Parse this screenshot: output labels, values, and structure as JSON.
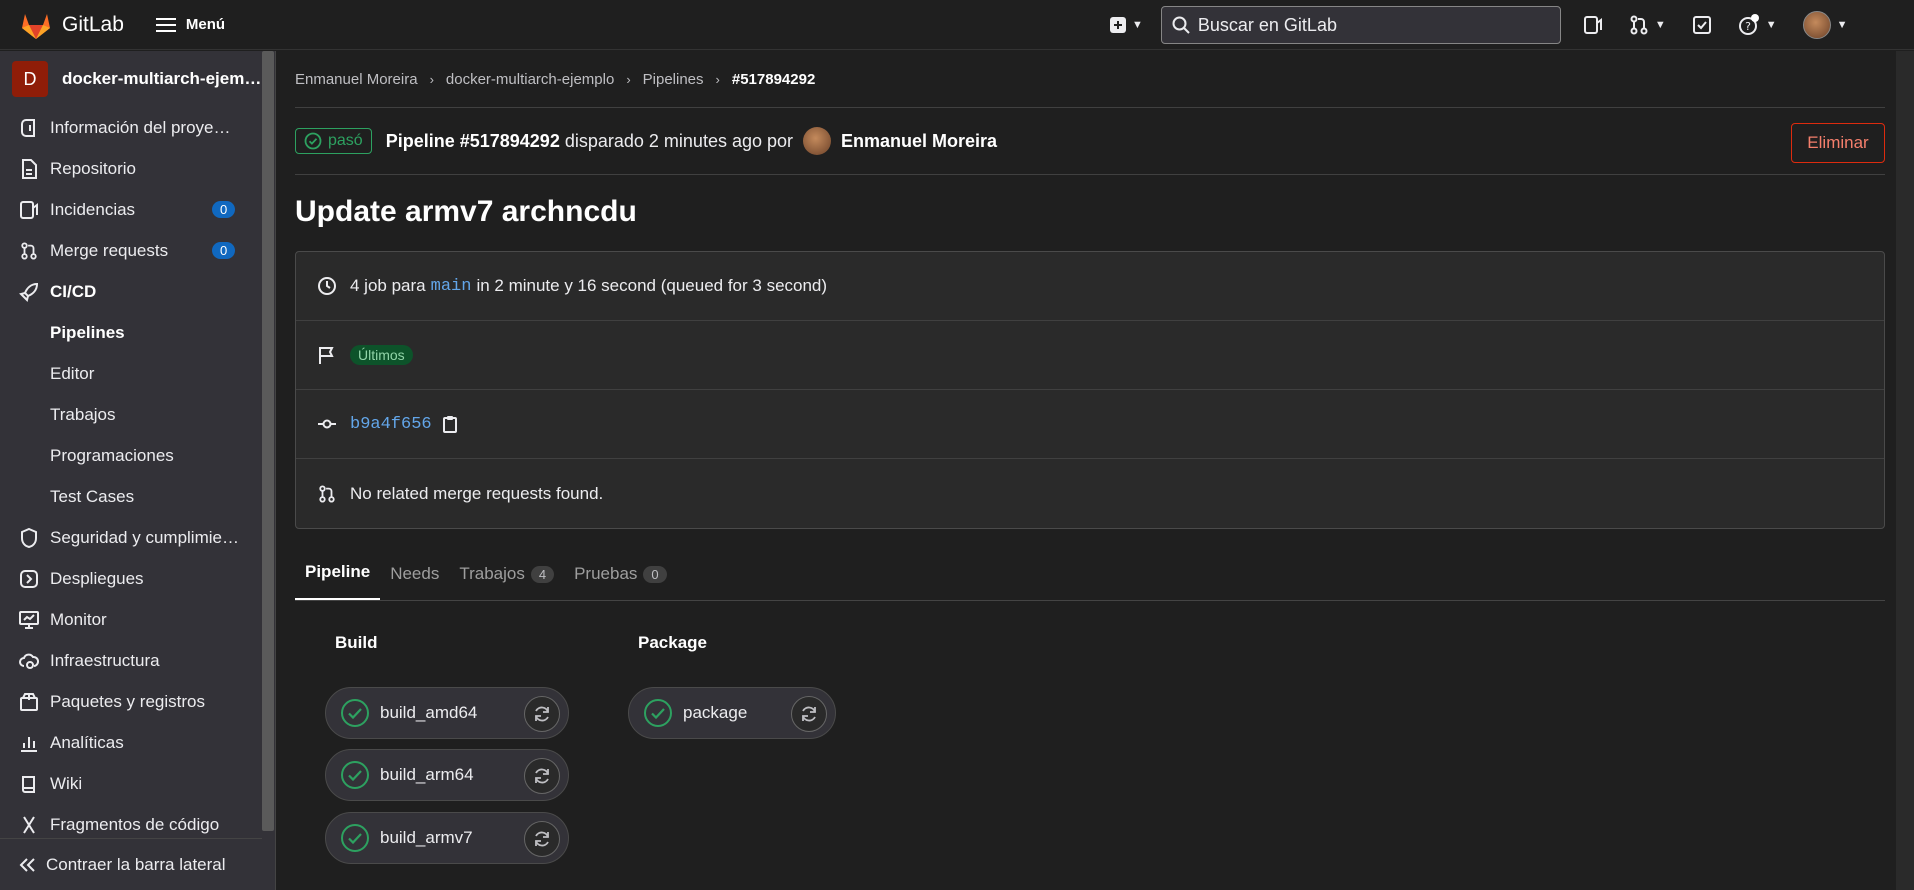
{
  "topbar": {
    "brand": "GitLab",
    "menu_label": "Menú",
    "search_placeholder": "Buscar en GitLab"
  },
  "sidebar": {
    "project_initial": "D",
    "project_name": "docker-multiarch-ejemplo",
    "items": [
      {
        "label": "Información del proye…",
        "icon": "info-icon"
      },
      {
        "label": "Repositorio",
        "icon": "doc-icon"
      },
      {
        "label": "Incidencias",
        "icon": "issues-icon",
        "count": "0"
      },
      {
        "label": "Merge requests",
        "icon": "merge-request-icon",
        "count": "0"
      },
      {
        "label": "CI/CD",
        "icon": "rocket-icon"
      }
    ],
    "cicd_sub": [
      "Pipelines",
      "Editor",
      "Trabajos",
      "Programaciones",
      "Test Cases"
    ],
    "items_after": [
      {
        "label": "Seguridad y cumplimie…",
        "icon": "shield-icon"
      },
      {
        "label": "Despliegues",
        "icon": "deployments-icon"
      },
      {
        "label": "Monitor",
        "icon": "monitor-icon"
      },
      {
        "label": "Infraestructura",
        "icon": "cloud-gear-icon"
      },
      {
        "label": "Paquetes y registros",
        "icon": "package-icon"
      },
      {
        "label": "Analíticas",
        "icon": "chart-icon"
      },
      {
        "label": "Wiki",
        "icon": "book-icon"
      },
      {
        "label": "Fragmentos de código",
        "icon": "snippet-icon"
      }
    ],
    "collapse_label": "Contraer la barra lateral"
  },
  "breadcrumb": [
    "Enmanuel Moreira",
    "docker-multiarch-ejemplo",
    "Pipelines",
    "#517894292"
  ],
  "pipeline": {
    "status": "pasó",
    "id_label": "Pipeline #517894292",
    "triggered_text": "disparado 2 minutes ago por",
    "author": "Enmanuel Moreira",
    "delete_label": "Eliminar",
    "commit_title": "Update armv7 archncdu",
    "info_jobs_prefix": "4 job para",
    "info_branch": "main",
    "info_jobs_suffix": "in 2 minute y 16 second (queued for 3 second)",
    "latest_tag": "Últimos",
    "sha": "b9a4f656",
    "mr_text": "No related merge requests found."
  },
  "tabs": [
    {
      "label": "Pipeline"
    },
    {
      "label": "Needs"
    },
    {
      "label": "Trabajos",
      "count": "4"
    },
    {
      "label": "Pruebas",
      "count": "0"
    }
  ],
  "stages": [
    {
      "title": "Build",
      "jobs": [
        "build_amd64",
        "build_arm64",
        "build_armv7"
      ]
    },
    {
      "title": "Package",
      "jobs": [
        "package"
      ]
    }
  ],
  "colors": {
    "success": "#2da160",
    "danger": "#dd2b0e",
    "accent": "#1068bf"
  }
}
